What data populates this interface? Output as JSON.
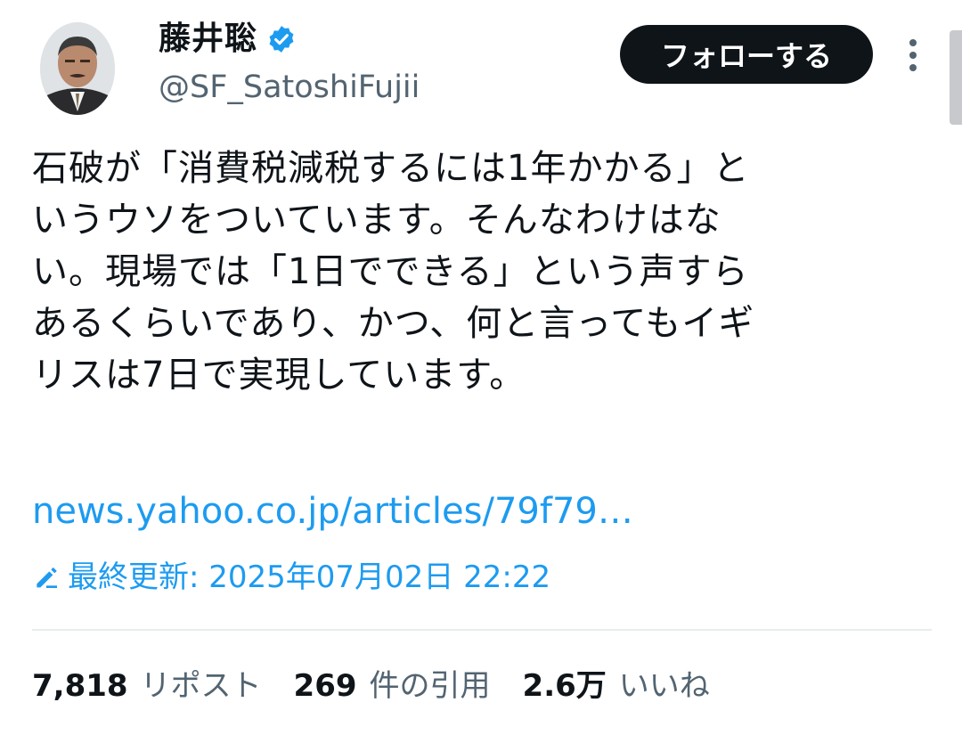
{
  "author": {
    "name": "藤井聡",
    "handle": "@SF_SatoshiFujii",
    "verified_color": "#1d9bf0"
  },
  "follow_button_label": "フォローする",
  "tweet": {
    "text": "石破が「消費税減税するには1年かかる」と\nいうウソをついています。そんなわけはな\nい。現場では「1日でできる」という声すら\nあるくらいであり、かつ、何と言ってもイギ\nリスは7日で実現しています。",
    "link": "news.yahoo.co.jp/articles/79f79…"
  },
  "edited_label": "最終更新: 2025年07月02日 22:22",
  "stats": [
    {
      "num": "7,818",
      "label": "リポスト"
    },
    {
      "num": "269",
      "label": "件の引用"
    },
    {
      "num": "2.6万",
      "label": "いいね"
    }
  ],
  "colors": {
    "accent": "#1d9bf0",
    "button_bg": "#0f1419",
    "secondary_text": "#536471"
  }
}
